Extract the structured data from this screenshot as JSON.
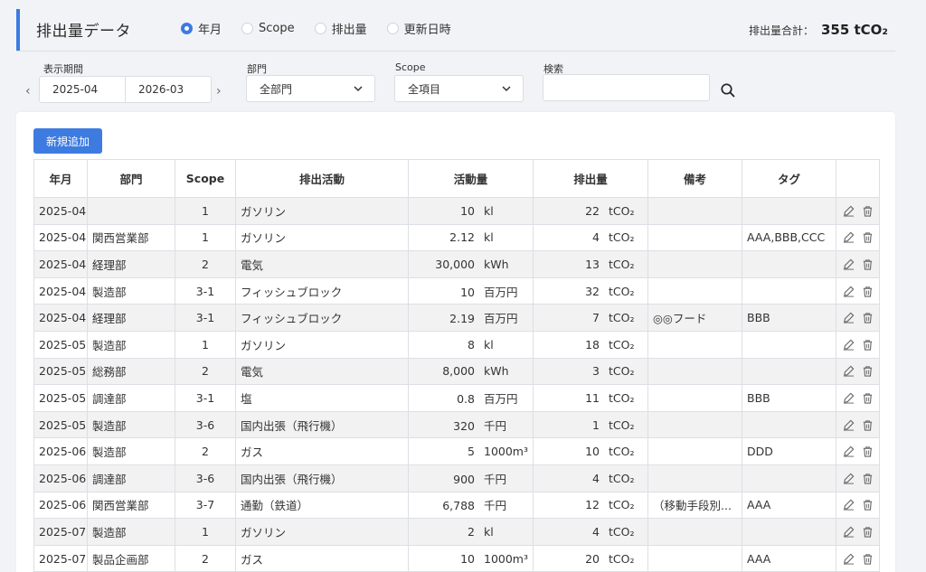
{
  "header": {
    "title": "排出量データ",
    "radio_options": [
      {
        "label": "年月",
        "selected": true
      },
      {
        "label": "Scope",
        "selected": false
      },
      {
        "label": "排出量",
        "selected": false
      },
      {
        "label": "更新日時",
        "selected": false
      }
    ],
    "total_label": "排出量合計：",
    "total_value": "355 tCO₂"
  },
  "filters": {
    "period_label": "表示期間",
    "period_start": "2025-04",
    "period_end": "2026-03",
    "department_label": "部門",
    "department_value": "全部門",
    "scope_label": "Scope",
    "scope_value": "全項目",
    "search_label": "検索",
    "search_value": ""
  },
  "toolbar": {
    "add_label": "新規追加"
  },
  "table": {
    "columns": [
      "年月",
      "部門",
      "Scope",
      "排出活動",
      "活動量",
      "排出量",
      "備考",
      "タグ",
      ""
    ],
    "rows": [
      {
        "month": "2025-04",
        "dept": "",
        "scope": "1",
        "activity": "ガソリン",
        "amount": "10",
        "amount_unit": "kl",
        "emission": "22",
        "emission_unit": "tCO₂",
        "note": "",
        "tag": ""
      },
      {
        "month": "2025-04",
        "dept": "関西営業部",
        "scope": "1",
        "activity": "ガソリン",
        "amount": "2.12",
        "amount_unit": "kl",
        "emission": "4",
        "emission_unit": "tCO₂",
        "note": "",
        "tag": "AAA,BBB,CCC"
      },
      {
        "month": "2025-04",
        "dept": "経理部",
        "scope": "2",
        "activity": "電気",
        "amount": "30,000",
        "amount_unit": "kWh",
        "emission": "13",
        "emission_unit": "tCO₂",
        "note": "",
        "tag": ""
      },
      {
        "month": "2025-04",
        "dept": "製造部",
        "scope": "3-1",
        "activity": "フィッシュブロック",
        "amount": "10",
        "amount_unit": "百万円",
        "emission": "32",
        "emission_unit": "tCO₂",
        "note": "",
        "tag": ""
      },
      {
        "month": "2025-04",
        "dept": "経理部",
        "scope": "3-1",
        "activity": "フィッシュブロック",
        "amount": "2.19",
        "amount_unit": "百万円",
        "emission": "7",
        "emission_unit": "tCO₂",
        "note": "◎◎フード",
        "tag": "BBB"
      },
      {
        "month": "2025-05",
        "dept": "製造部",
        "scope": "1",
        "activity": "ガソリン",
        "amount": "8",
        "amount_unit": "kl",
        "emission": "18",
        "emission_unit": "tCO₂",
        "note": "",
        "tag": ""
      },
      {
        "month": "2025-05",
        "dept": "総務部",
        "scope": "2",
        "activity": "電気",
        "amount": "8,000",
        "amount_unit": "kWh",
        "emission": "3",
        "emission_unit": "tCO₂",
        "note": "",
        "tag": ""
      },
      {
        "month": "2025-05",
        "dept": "調達部",
        "scope": "3-1",
        "activity": "塩",
        "amount": "0.8",
        "amount_unit": "百万円",
        "emission": "11",
        "emission_unit": "tCO₂",
        "note": "",
        "tag": "BBB"
      },
      {
        "month": "2025-05",
        "dept": "製造部",
        "scope": "3-6",
        "activity": "国内出張（飛行機）",
        "amount": "320",
        "amount_unit": "千円",
        "emission": "1",
        "emission_unit": "tCO₂",
        "note": "",
        "tag": ""
      },
      {
        "month": "2025-06",
        "dept": "製造部",
        "scope": "2",
        "activity": "ガス",
        "amount": "5",
        "amount_unit": "1000m³",
        "emission": "10",
        "emission_unit": "tCO₂",
        "note": "",
        "tag": "DDD"
      },
      {
        "month": "2025-06",
        "dept": "調達部",
        "scope": "3-6",
        "activity": "国内出張（飛行機）",
        "amount": "900",
        "amount_unit": "千円",
        "emission": "4",
        "emission_unit": "tCO₂",
        "note": "",
        "tag": ""
      },
      {
        "month": "2025-06",
        "dept": "関西営業部",
        "scope": "3-7",
        "activity": "通勤（鉄道）",
        "amount": "6,788",
        "amount_unit": "千円",
        "emission": "12",
        "emission_unit": "tCO₂",
        "note": "（移動手段別...",
        "tag": "AAA"
      },
      {
        "month": "2025-07",
        "dept": "製造部",
        "scope": "1",
        "activity": "ガソリン",
        "amount": "2",
        "amount_unit": "kl",
        "emission": "4",
        "emission_unit": "tCO₂",
        "note": "",
        "tag": ""
      },
      {
        "month": "2025-07",
        "dept": "製品企画部",
        "scope": "2",
        "activity": "ガス",
        "amount": "10",
        "amount_unit": "1000m³",
        "emission": "20",
        "emission_unit": "tCO₂",
        "note": "",
        "tag": "AAA"
      }
    ]
  },
  "icons": {
    "edit": "edit-icon",
    "delete": "trash-icon",
    "search": "search-icon",
    "prev": "chevron-left-icon",
    "next": "chevron-right-icon",
    "dropdown": "chevron-down-icon"
  },
  "colors": {
    "accent": "#3d7be0"
  }
}
